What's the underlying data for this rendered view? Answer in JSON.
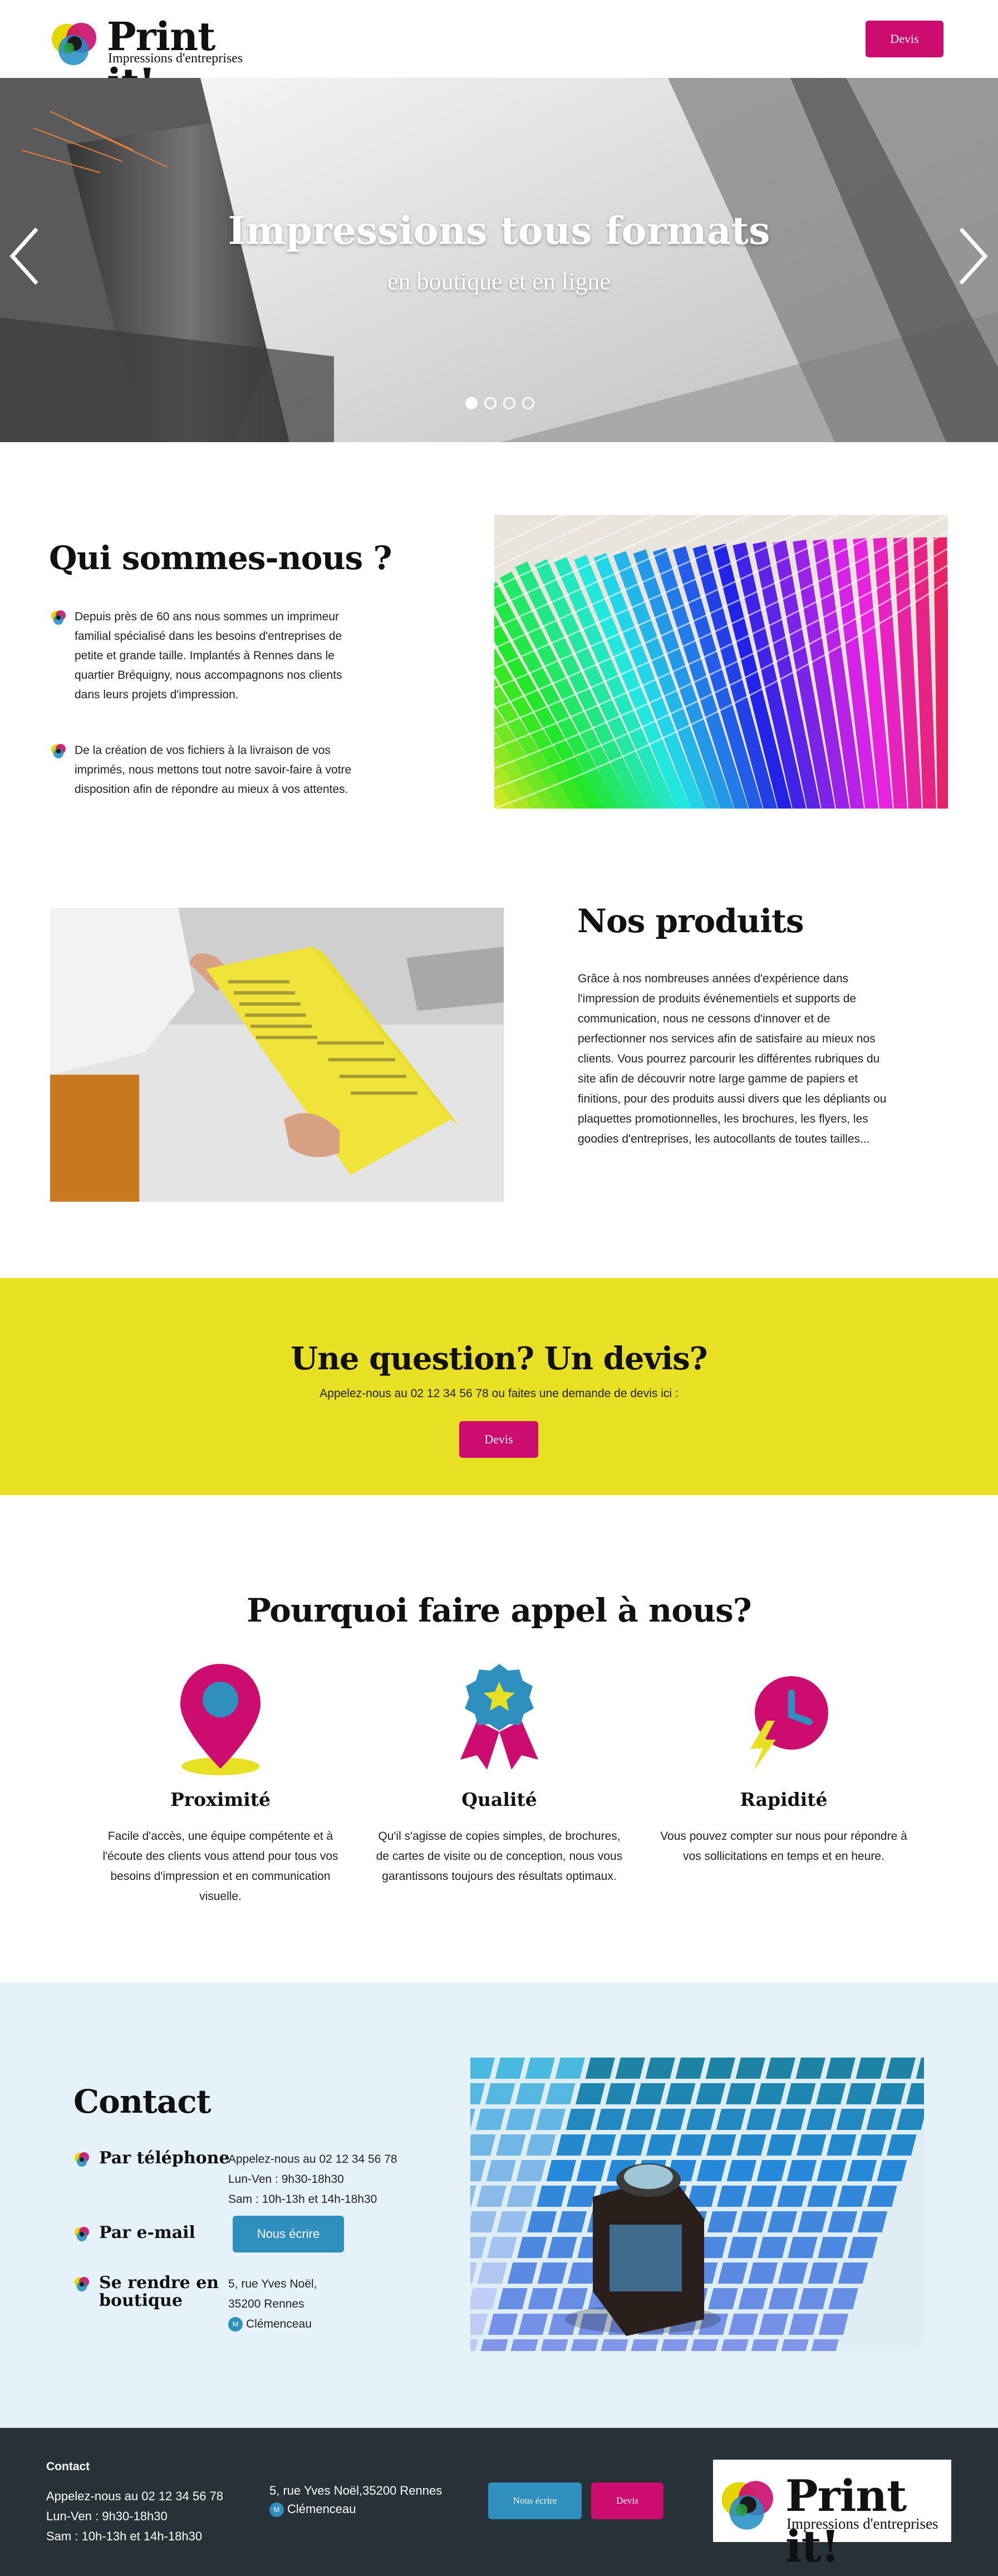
{
  "brand": {
    "name": "Print it!",
    "tagline": "Impressions d'entreprises"
  },
  "header": {
    "devis_label": "Devis"
  },
  "hero": {
    "title": "Impressions tous formats",
    "subtitle": "en boutique et en ligne",
    "slide_count": 4,
    "active_slide": 1
  },
  "about": {
    "title": "Qui sommes-nous ?",
    "bullets": [
      "Depuis près de 60 ans nous sommes un imprimeur familial spécialisé dans les besoins d'entreprises de petite et grande taille. Implantés à Rennes dans le quartier Bréquigny, nous accompagnons nos clients dans leurs projets d'impression.",
      "De la création de vos fichiers à la livraison de vos imprimés, nous mettons tout notre savoir-faire à votre disposition afin de répondre au mieux à vos attentes."
    ]
  },
  "products": {
    "title": "Nos produits",
    "text": "Grâce à nos nombreuses années d'expérience dans l'impression de produits événementiels et supports de communication, nous ne cessons d'innover et de perfectionner nos services afin de satisfaire au mieux nos clients. Vous pourrez parcourir les différentes rubriques du site afin de découvrir notre large gamme de papiers et finitions, pour des produits aussi divers que les dépliants ou plaquettes promotionnelles, les brochures, les flyers, les goodies d'entreprises, les autocollants de toutes tailles..."
  },
  "cta": {
    "title": "Une question? Un devis?",
    "subtitle": "Appelez-nous au 02 12 34 56 78 ou faites une demande de devis ici :",
    "button": "Devis"
  },
  "why": {
    "title": "Pourquoi faire appel à nous?",
    "items": [
      {
        "name": "Proximité",
        "icon": "location-pin-icon",
        "text": "Facile d'accès, une équipe compétente et à l'écoute des clients vous attend pour tous vos besoins d'impression et en communication visuelle."
      },
      {
        "name": "Qualité",
        "icon": "award-ribbon-icon",
        "text": "Qu'il s'agisse de copies simples, de brochures, de cartes de visite ou de conception, nous vous garantissons toujours des résultats optimaux."
      },
      {
        "name": "Rapidité",
        "icon": "clock-lightning-icon",
        "text": "Vous pouvez compter sur nous pour répondre à vos sollicitations en temps et en heure."
      }
    ]
  },
  "contact": {
    "title": "Contact",
    "phone_label": "Par téléphone",
    "phone_lines": [
      "Appelez-nous au 02 12 34 56 78",
      "Lun-Ven : 9h30-18h30",
      "Sam : 10h-13h et 14h-18h30"
    ],
    "email_label": "Par e-mail",
    "email_button": "Nous écrire",
    "visit_label": "Se rendre en boutique",
    "visit_lines": [
      "5, rue Yves Noël,",
      "35200 Rennes"
    ],
    "metro": "Clémenceau",
    "metro_badge": "M"
  },
  "footer": {
    "heading": "Contact",
    "lines": [
      "Appelez-nous au 02 12 34 56 78",
      "Lun-Ven : 9h30-18h30",
      "Sam : 10h-13h et 14h-18h30"
    ],
    "address": "5, rue Yves Noël,35200 Rennes",
    "metro": "Clémenceau",
    "metro_badge": "M",
    "write_button": "Nous écrire",
    "devis_button": "Devis"
  },
  "colors": {
    "accent_pink": "#cc0c6e",
    "accent_blue": "#2f8fbf",
    "cta_yellow": "#e8e123",
    "contact_bg": "#e6f2fa",
    "footer_bg": "#263238"
  }
}
